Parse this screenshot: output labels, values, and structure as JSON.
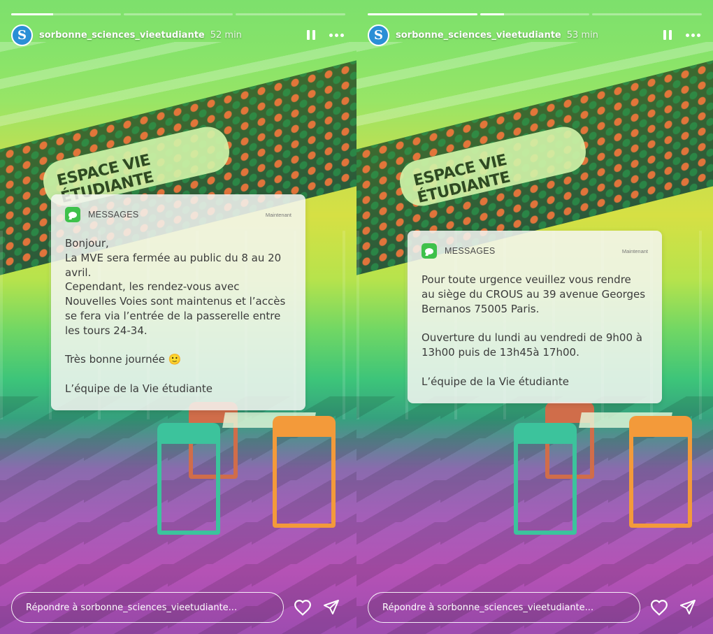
{
  "stories": [
    {
      "progress": [
        0.38,
        0.0,
        0.0
      ],
      "username": "sorbonne_sciences_vieetudiante",
      "time": "52 min",
      "avatar_letter": "S",
      "notification": {
        "app": "MESSAGES",
        "stamp": "Maintenant",
        "lines": [
          "Bonjour,",
          "La MVE sera fermée au public du 8 au 20",
          "avril.",
          "Cependant, les rendez-vous avec",
          "Nouvelles Voies sont maintenus et l’accès",
          "se fera via l’entrée de la passerelle entre",
          "les tours 24-34.",
          "",
          "Très bonne journée 🙂",
          "",
          "L’équipe de la Vie étudiante"
        ]
      },
      "reply_placeholder": "Répondre à sorbonne_sciences_vieetudiante..."
    },
    {
      "progress": [
        1.0,
        0.22,
        0.0
      ],
      "username": "sorbonne_sciences_vieetudiante",
      "time": "53 min",
      "avatar_letter": "S",
      "notification": {
        "app": "MESSAGES",
        "stamp": "Maintenant",
        "lines": [
          "Pour toute urgence veuillez vous rendre",
          "au siège du CROUS au 39 avenue Georges",
          "Bernanos 75005 Paris.",
          "",
          "Ouverture du lundi au vendredi de 9h00 à",
          "13h00 puis de 13h45à 17h00.",
          "",
          "L’équipe de la Vie étudiante"
        ]
      },
      "reply_placeholder": "Répondre à sorbonne_sciences_vieetudiante..."
    }
  ],
  "background": {
    "banner_text": "ESPACE VIE ÉTUDIANTE"
  },
  "icons": [
    "pause-icon",
    "more-icon",
    "heart-icon",
    "send-icon",
    "messages-app-icon"
  ],
  "colors": {
    "messages_green": "#3ec14b",
    "avatar_blue": "#2a8fd6"
  }
}
